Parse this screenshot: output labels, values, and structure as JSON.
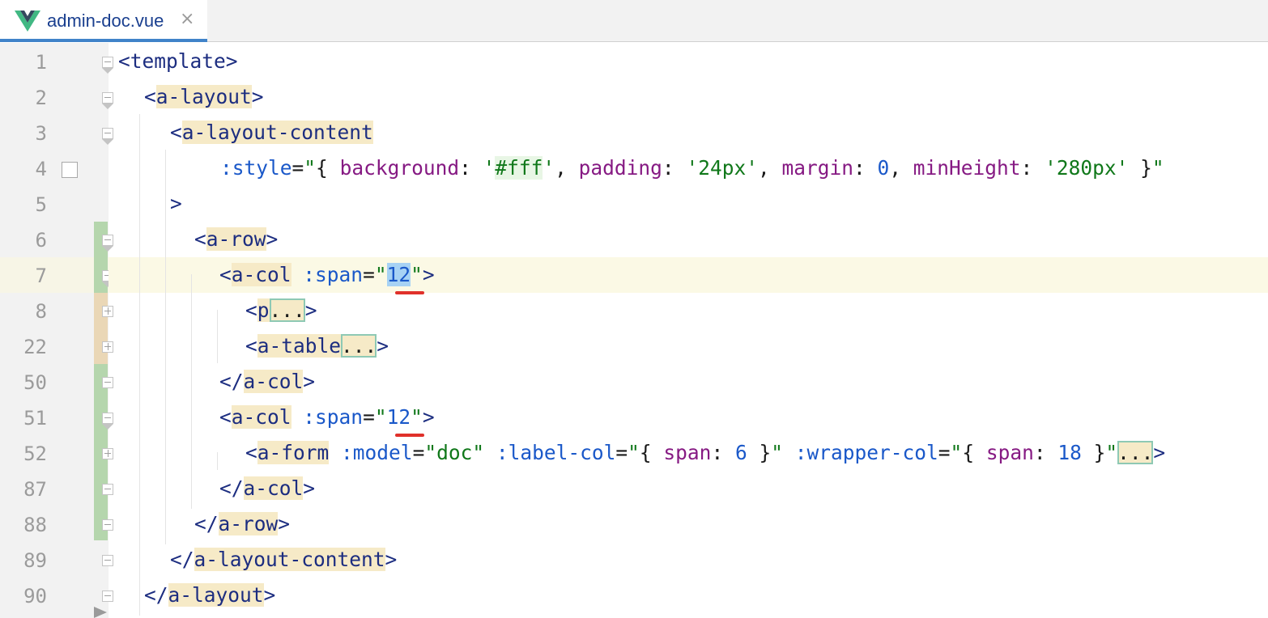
{
  "tab": {
    "filename": "admin-doc.vue",
    "close_glyph": "×",
    "icon": "vue-logo-icon"
  },
  "gutter": {
    "line_numbers": [
      "1",
      "2",
      "3",
      "4",
      "5",
      "6",
      "7",
      "8",
      "22",
      "50",
      "51",
      "52",
      "87",
      "88",
      "89",
      "90"
    ]
  },
  "colors": {
    "tag": "#1c2d80",
    "attribute": "#1a58c9",
    "string": "#10781a",
    "number": "#1a58c9",
    "keyword": "#861a83",
    "tag_highlight": "#f6eac7",
    "current_line": "#fbf9e5",
    "selection": "#a7d2f4",
    "change_bar_added": "#b5d6ad",
    "change_bar_modified": "#ead7b6"
  },
  "code": {
    "l1": {
      "open": "<",
      "tag": "template",
      "close": ">"
    },
    "l2": {
      "open": "<",
      "tag": "a-layout",
      "close": ">"
    },
    "l3": {
      "open": "<",
      "tag": "a-layout-content"
    },
    "l4": {
      "attr": ":style",
      "eq": "=",
      "q1": "\"",
      "b1": "{ ",
      "k1": "background",
      "c1": ": ",
      "s1a": "'",
      "s1": "#fff",
      "s1b": "'",
      "sep1": ", ",
      "k2": "padding",
      "c2": ": ",
      "s2": "'24px'",
      "sep2": ", ",
      "k3": "margin",
      "c3": ": ",
      "n3": "0",
      "sep3": ", ",
      "k4": "minHeight",
      "c4": ": ",
      "s4": "'280px'",
      "b2": " }",
      "q2": "\""
    },
    "l5": {
      "close": ">"
    },
    "l6": {
      "open": "<",
      "tag": "a-row",
      "close": ">"
    },
    "l7": {
      "open": "<",
      "tag": "a-col",
      "sp": " ",
      "attr": ":span",
      "eq": "=",
      "q1": "\"",
      "num": "12",
      "q2": "\"",
      "close": ">"
    },
    "l8": {
      "open": "<",
      "tag": "p",
      "fold": "...",
      "close": ">"
    },
    "l22": {
      "open": "<",
      "tag": "a-table",
      "fold": "...",
      "close": ">"
    },
    "l50": {
      "open": "</",
      "tag": "a-col",
      "close": ">"
    },
    "l51": {
      "open": "<",
      "tag": "a-col",
      "sp": " ",
      "attr": ":span",
      "eq": "=",
      "q1": "\"",
      "num": "12",
      "q2": "\"",
      "close": ">"
    },
    "l52": {
      "open": "<",
      "tag": "a-form",
      "sp1": " ",
      "a1": ":model",
      "eq1": "=",
      "s1": "\"doc\"",
      "sp2": " ",
      "a2": ":label-col",
      "eq2": "=",
      "q2a": "\"",
      "b2a": "{ ",
      "k2": "span",
      "c2": ": ",
      "n2": "6",
      "b2b": " }",
      "q2b": "\"",
      "sp3": " ",
      "a3": ":wrapper-col",
      "eq3": "=",
      "q3a": "\"",
      "b3a": "{ ",
      "k3": "span",
      "c3": ": ",
      "n3": "18",
      "b3b": " }",
      "q3b": "\"",
      "fold": "...",
      "close": ">"
    },
    "l87": {
      "open": "</",
      "tag": "a-col",
      "close": ">"
    },
    "l88": {
      "open": "</",
      "tag": "a-row",
      "close": ">"
    },
    "l89": {
      "open": "</",
      "tag": "a-layout-content",
      "close": ">"
    },
    "l90": {
      "open": "</",
      "tag": "a-layout",
      "close": ">"
    }
  }
}
